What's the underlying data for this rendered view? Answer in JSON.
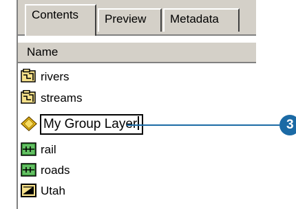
{
  "tabs": [
    {
      "label": "Contents",
      "active": true
    },
    {
      "label": "Preview",
      "active": false
    },
    {
      "label": "Metadata",
      "active": false
    }
  ],
  "list": {
    "header": "Name",
    "items": [
      {
        "label": "rivers",
        "icon": "map-layer-icon"
      },
      {
        "label": "streams",
        "icon": "map-layer-icon"
      },
      {
        "label": "My Group Layer",
        "icon": "group-layer-icon",
        "editing": true
      },
      {
        "label": "rail",
        "icon": "line-layer-icon"
      },
      {
        "label": "roads",
        "icon": "line-layer-icon"
      },
      {
        "label": "Utah",
        "icon": "polygon-layer-icon"
      }
    ]
  },
  "callout": {
    "number": "3",
    "color": "#1b6aa5"
  }
}
